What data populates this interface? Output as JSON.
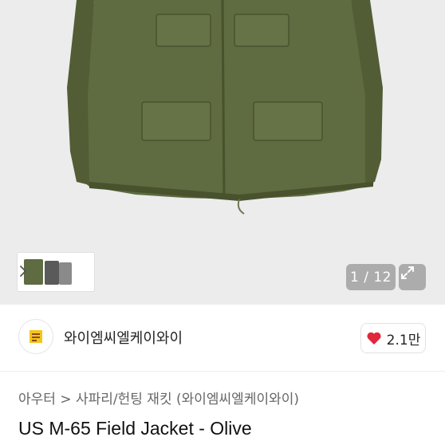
{
  "gallery": {
    "counter": "1 / 12"
  },
  "shop": {
    "name": "와이엠씨엘케이와이",
    "likes": "2.1만"
  },
  "product": {
    "breadcrumb": "아우터 > 사파리/헌팅 재킷 (와이엠씨엘케이와이)",
    "title": "US M-65 Field Jacket - Olive"
  },
  "colors": {
    "jacket": "#5e6a3f",
    "heart": "#e0283a",
    "logo_yellow": "#f5c518"
  }
}
